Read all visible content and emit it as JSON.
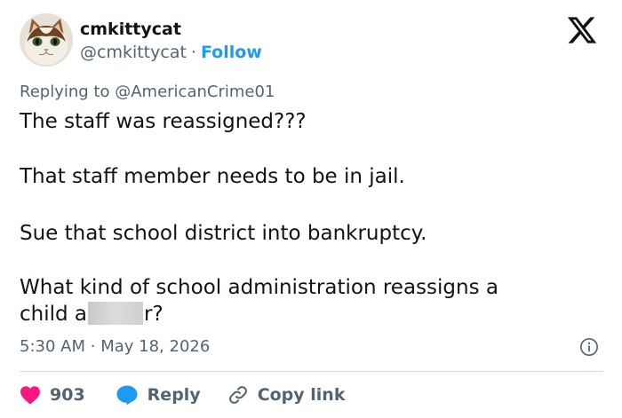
{
  "user": {
    "display_name": "cmkittycat",
    "handle": "@cmkittycat",
    "separator": "·",
    "follow_label": "Follow"
  },
  "reply": {
    "prefix": "Replying to",
    "mention": "@AmericanCrime01"
  },
  "tweet": {
    "line1": "The staff was reassigned???",
    "line2": "That staff member needs to be in jail.",
    "line3": "Sue that school district into bankruptcy.",
    "line4": "What kind of school administration reassigns a",
    "line5_start": "child a",
    "line5_end": "r?"
  },
  "timestamp": {
    "time": "5:30 AM",
    "separator": "·",
    "date": "May 18, 2026"
  },
  "actions": {
    "like_count": "903",
    "reply_label": "Reply",
    "copy_label": "Copy link"
  },
  "colors": {
    "text": "#0f1419",
    "secondary": "#536471",
    "accent": "#1d9bf0",
    "like": "#f91880",
    "divider": "#cfd9de"
  },
  "icons": {
    "brand": "x-logo-icon",
    "info": "info-icon",
    "like": "heart-icon",
    "reply": "speech-bubble-icon",
    "copy": "link-icon"
  }
}
